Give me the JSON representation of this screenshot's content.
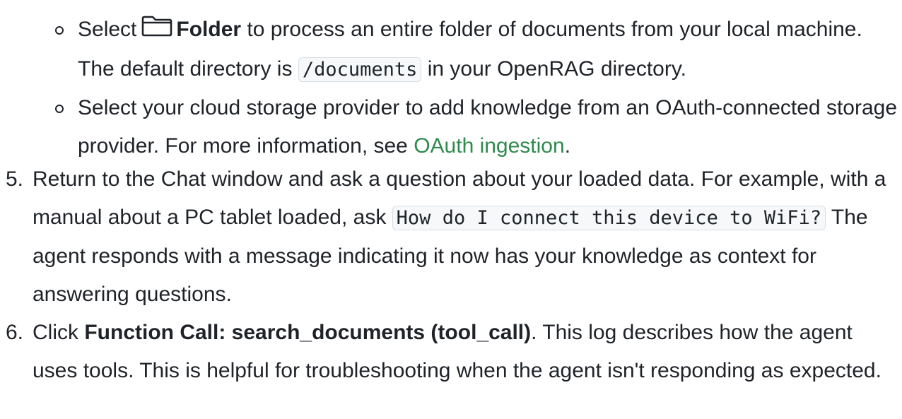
{
  "sub_items": [
    {
      "select_label": "Select",
      "folder_label": "Folder",
      "text_a": " to process an entire folder of documents from your local machine. The default directory is ",
      "code": "/documents",
      "text_b": " in your OpenRAG directory."
    },
    {
      "text_a": "Select your cloud storage provider to add knowledge from an OAuth-connected storage provider. For more information, see ",
      "link_label": "OAuth ingestion",
      "text_b": "."
    }
  ],
  "steps": [
    {
      "number": "5.",
      "text_a": "Return to the Chat window and ask a question about your loaded data. For example, with a manual about a PC tablet loaded, ask ",
      "code": "How do I connect this device to WiFi?",
      "text_b": " The agent responds with a message indicating it now has your knowledge as context for answering questions."
    },
    {
      "number": "6.",
      "text_a": "Click ",
      "bold": "Function Call: search_documents (tool_call)",
      "text_b": ". This log describes how the agent uses tools. This is helpful for troubleshooting when the agent isn't responding as expected."
    }
  ],
  "icons": {
    "folder": "folder-icon"
  },
  "colors": {
    "link": "#2f8a4d",
    "text": "#1f2328",
    "code_bg": "#f6f8fa"
  }
}
